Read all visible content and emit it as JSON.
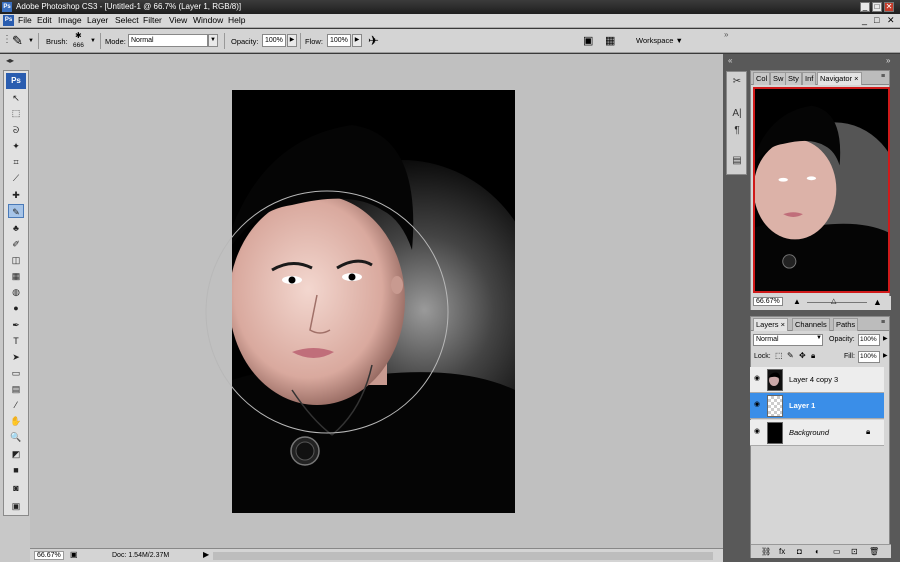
{
  "title_bar": {
    "app_icon": "Ps",
    "title": "Adobe Photoshop CS3 - [Untitled-1 @ 66.7% (Layer 1, RGB/8)]",
    "controls": [
      "_",
      "□",
      "✕"
    ]
  },
  "menu": {
    "logo": "Ps",
    "items": [
      "File",
      "Edit",
      "Image",
      "Layer",
      "Select",
      "Filter",
      "View",
      "Window",
      "Help"
    ],
    "doc_controls": [
      "_",
      "□",
      "✕"
    ]
  },
  "options_bar": {
    "brush_label": "Brush:",
    "brush_size": "666",
    "mode_label": "Mode:",
    "mode_value": "Normal",
    "opacity_label": "Opacity:",
    "opacity_value": "100%",
    "flow_label": "Flow:",
    "flow_value": "100%",
    "workspace_label": "Workspace ▼"
  },
  "toolbox": {
    "logo": "Ps",
    "tools": [
      {
        "name": "move-tool-icon",
        "glyph": "↖"
      },
      {
        "name": "marquee-tool-icon",
        "glyph": "⬚"
      },
      {
        "name": "lasso-tool-icon",
        "glyph": "ᘐ"
      },
      {
        "name": "magic-wand-tool-icon",
        "glyph": "✦"
      },
      {
        "name": "crop-tool-icon",
        "glyph": "⌗"
      },
      {
        "name": "slice-tool-icon",
        "glyph": "⟋"
      },
      {
        "name": "healing-brush-tool-icon",
        "glyph": "✚"
      },
      {
        "name": "brush-tool-icon",
        "glyph": "✎"
      },
      {
        "name": "clone-stamp-tool-icon",
        "glyph": "♣"
      },
      {
        "name": "history-brush-tool-icon",
        "glyph": "✐"
      },
      {
        "name": "eraser-tool-icon",
        "glyph": "◫"
      },
      {
        "name": "gradient-tool-icon",
        "glyph": "▦"
      },
      {
        "name": "blur-tool-icon",
        "glyph": "◍"
      },
      {
        "name": "dodge-tool-icon",
        "glyph": "●"
      },
      {
        "name": "pen-tool-icon",
        "glyph": "✒"
      },
      {
        "name": "type-tool-icon",
        "glyph": "T"
      },
      {
        "name": "path-selection-tool-icon",
        "glyph": "➤"
      },
      {
        "name": "shape-tool-icon",
        "glyph": "▭"
      },
      {
        "name": "notes-tool-icon",
        "glyph": "▤"
      },
      {
        "name": "eyedropper-tool-icon",
        "glyph": "⁄"
      },
      {
        "name": "hand-tool-icon",
        "glyph": "✋"
      },
      {
        "name": "zoom-tool-icon",
        "glyph": "🔍"
      },
      {
        "name": "swap-colors-icon",
        "glyph": "◩"
      },
      {
        "name": "foreground-background-colors",
        "glyph": "■"
      },
      {
        "name": "quick-mask-icon",
        "glyph": "◙"
      },
      {
        "name": "screen-mode-icon",
        "glyph": "▣"
      }
    ]
  },
  "navigator_panel": {
    "tabs": [
      "Col",
      "Sw",
      "Sty",
      "Inf",
      "Navigator ×"
    ],
    "zoom": "66.67%",
    "controls": [
      "«",
      "»"
    ]
  },
  "layers_panel": {
    "tabs": [
      "Layers ×",
      "Channels",
      "Paths"
    ],
    "blend_mode": "Normal",
    "opacity_label": "Opacity:",
    "opacity_value": "100%",
    "lock_label": "Lock:",
    "fill_label": "Fill:",
    "fill_value": "100%",
    "layers": [
      {
        "name": "Layer 4 copy 3",
        "selected": false
      },
      {
        "name": "Layer 1",
        "selected": true
      },
      {
        "name": "Background",
        "selected": false
      }
    ],
    "bottom_icons": [
      "link-icon",
      "fx-icon",
      "mask-icon",
      "adjustment-icon",
      "group-icon",
      "new-layer-icon",
      "trash-icon"
    ]
  },
  "status_bar": {
    "zoom": "66.67%",
    "doc_info": "Doc: 1.54M/2.37M"
  },
  "colors": {
    "selection_blue": "#3a8ee8",
    "navigator_red": "#d01a1a",
    "canvas_gray": "#c0c0c0"
  }
}
